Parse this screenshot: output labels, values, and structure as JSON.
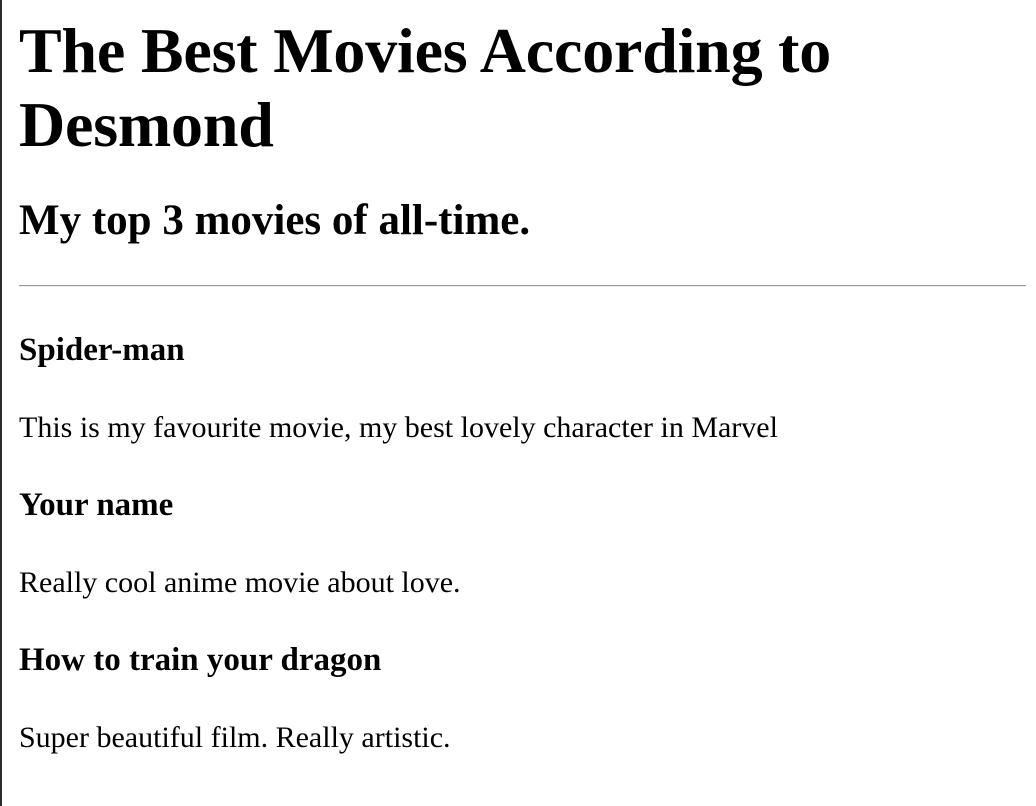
{
  "page": {
    "title": "The Best Movies According to Desmond",
    "subtitle": "My top 3 movies of all-time."
  },
  "movies": [
    {
      "title": "Spider-man",
      "description": "This is my favourite movie, my best lovely character in Marvel"
    },
    {
      "title": "Your name",
      "description": "Really cool anime movie about love."
    },
    {
      "title": "How to train your dragon",
      "description": "Super beautiful film. Really artistic."
    }
  ]
}
